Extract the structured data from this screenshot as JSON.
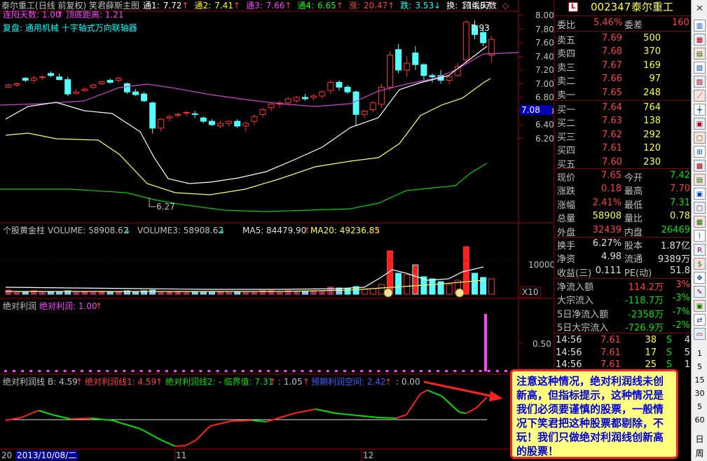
{
  "header": {
    "stock_name": "泰尔重工",
    "chart_mode": "(日线 前复权)",
    "indicator_name": "笑君薛斯主图",
    "channels": [
      {
        "label": "通1:",
        "value": "7.72",
        "arrow": "↑",
        "color": "#ffffff"
      },
      {
        "label": "通2:",
        "value": "7.41",
        "arrow": "↑",
        "color": "#ffff00"
      },
      {
        "label": "通3:",
        "value": "7.66",
        "arrow": "↑",
        "color": "#ff40ff"
      },
      {
        "label": "通4:",
        "value": "6.65",
        "arrow": "↑",
        "color": "#00ff00"
      },
      {
        "label": "涨:",
        "value": "20.47",
        "arrow": "↑",
        "color": "#ff4040"
      },
      {
        "label": "跌:",
        "value": "3.53",
        "arrow": "↓",
        "color": "#00ffff"
      },
      {
        "label": "换:",
        "value": "114.87",
        "arrow": "↑",
        "color": "#ffffff"
      }
    ],
    "yang_days_label": "阳线天数",
    "consec_label": "连阳天数: 1.00",
    "bottom_dist_label": "顶底距离: 1.21",
    "fupan_label": "复盘",
    "fupan_text": ": 通用机械 十字轴式万向联轴器"
  },
  "price_axis": {
    "ticks": [
      "8.00",
      "7.80",
      "7.60",
      "7.40",
      "7.20",
      "7.00",
      "6.80",
      "6.60",
      "6.40",
      "6.20"
    ],
    "current_tag": "7.08",
    "high_marker": "7.93",
    "low_marker": "6.27"
  },
  "volume_panel": {
    "title": "个股黄金柱",
    "volume_label": "VOLUME: 58908.62",
    "volume_arrow": "↓",
    "volume3_label": "VOLUME3: 58908.62",
    "volume3_arrow": "↓",
    "ma5_label": "MA5: 84479.90",
    "ma5_arrow": "↑",
    "ma20_label": "MA20: 49236.85",
    "ma20_arrow": "↑",
    "axis_tick": "10000",
    "multiplier": "X10"
  },
  "profit_panel": {
    "title": "绝对利润",
    "value_label": "绝对利润: 1.00",
    "arrow": "↑",
    "axis_tick": "0.50"
  },
  "profit_line_panel": {
    "title": "绝对利润线",
    "b_label": "B: 4.59",
    "b_arrow": "↑",
    "line1_label": "绝对利润线1: 4.59",
    "line1_arrow": "↑",
    "line2_label": "绝对利润线2: - 临界值: 7.31",
    "line2_arrow": "↑",
    "val_label": ": 1.05",
    "val_arrow": "↑",
    "expect_label": "预期利润空间: 2.42",
    "expect_arrow": "↑",
    "zero_label": ": 0.00"
  },
  "date_axis": {
    "start": "20",
    "selected_date": "2013/10/08/二",
    "m11": "11",
    "m12": "12"
  },
  "quote_panel": {
    "logo": "L",
    "code": "002347",
    "name": "泰尔重工",
    "weibi_label": "委比",
    "weibi_value": "5.46%",
    "weicha_label": "委差",
    "weicha_value": "160",
    "asks": [
      {
        "label": "卖五",
        "price": "7.69",
        "vol": "500"
      },
      {
        "label": "卖四",
        "price": "7.68",
        "vol": "370"
      },
      {
        "label": "卖三",
        "price": "7.67",
        "vol": "169"
      },
      {
        "label": "卖二",
        "price": "7.66",
        "vol": "97"
      },
      {
        "label": "卖一",
        "price": "7.65",
        "vol": "248"
      }
    ],
    "bids": [
      {
        "label": "买一",
        "price": "7.64",
        "vol": "764"
      },
      {
        "label": "买二",
        "price": "7.63",
        "vol": "138"
      },
      {
        "label": "买三",
        "price": "7.62",
        "vol": "292"
      },
      {
        "label": "买四",
        "price": "7.61",
        "vol": "120"
      },
      {
        "label": "买五",
        "price": "7.60",
        "vol": "230"
      }
    ],
    "stats": [
      {
        "l1": "现价",
        "v1": "7.65",
        "c1": "red",
        "l2": "今开",
        "v2": "7.42",
        "c2": "grn"
      },
      {
        "l1": "涨跌",
        "v1": "0.18",
        "c1": "red",
        "l2": "最高",
        "v2": "7.70",
        "c2": "red"
      },
      {
        "l1": "涨幅",
        "v1": "2.41%",
        "c1": "red",
        "l2": "最低",
        "v2": "7.31",
        "c2": "grn"
      },
      {
        "l1": "总量",
        "v1": "58908",
        "c1": "yel",
        "l2": "量比",
        "v2": "0.78",
        "c2": "yel"
      },
      {
        "l1": "外盘",
        "v1": "32439",
        "c1": "red",
        "l2": "内盘",
        "v2": "26469",
        "c2": "grn"
      }
    ],
    "stats2": [
      {
        "l1": "换手",
        "v1": "6.27%",
        "c1": "wht",
        "l2": "股本",
        "v2": "1.87亿",
        "c2": "wht"
      },
      {
        "l1": "净资",
        "v1": "4.98",
        "c1": "wht",
        "l2": "流通",
        "v2": "9389万",
        "c2": "wht"
      },
      {
        "l1": "收益(三)",
        "v1": "0.111",
        "c1": "wht",
        "l2": "PE(动)",
        "v2": "51.8",
        "c2": "wht"
      }
    ],
    "flows": [
      {
        "label": "净流入额",
        "value": "114.2万",
        "pct": "3%",
        "color": "red"
      },
      {
        "label": "大宗流入",
        "value": "-118.7万",
        "pct": "-3%",
        "color": "grn"
      },
      {
        "label": "5日净流入额",
        "value": "-2358万",
        "pct": "-7%",
        "color": "grn"
      },
      {
        "label": "5日大宗流入",
        "value": "-726.9万",
        "pct": "-2%",
        "color": "grn"
      }
    ],
    "ticks": [
      {
        "time": "14:56",
        "price": "7.61",
        "vol": "38",
        "side": "S",
        "n": "4"
      },
      {
        "time": "14:56",
        "price": "7.61",
        "vol": "17",
        "side": "S",
        "n": "5"
      },
      {
        "time": "14:56",
        "price": "7.61",
        "vol": "25",
        "side": "S",
        "n": "1"
      }
    ]
  },
  "toolbar": {
    "close": "✕",
    "numbers": [
      "1",
      "5",
      "15",
      "30",
      "5",
      "60"
    ],
    "day": "日",
    "week": "周"
  },
  "note": {
    "text": "注意这种情况，绝对利润线未创新高，但指标提示，这种情况是我们必须要谨慎的股票，一般情况下笑君把这种股票都剔除，不玩！我们只做绝对利润线创新高的股票！"
  },
  "colors": {
    "up": "#ff3030",
    "down": "#54ffff",
    "ma_white": "#ffffff",
    "ma_yellow": "#ffff60",
    "ma_magenta": "#d040d0",
    "ma_green": "#00d000"
  }
}
